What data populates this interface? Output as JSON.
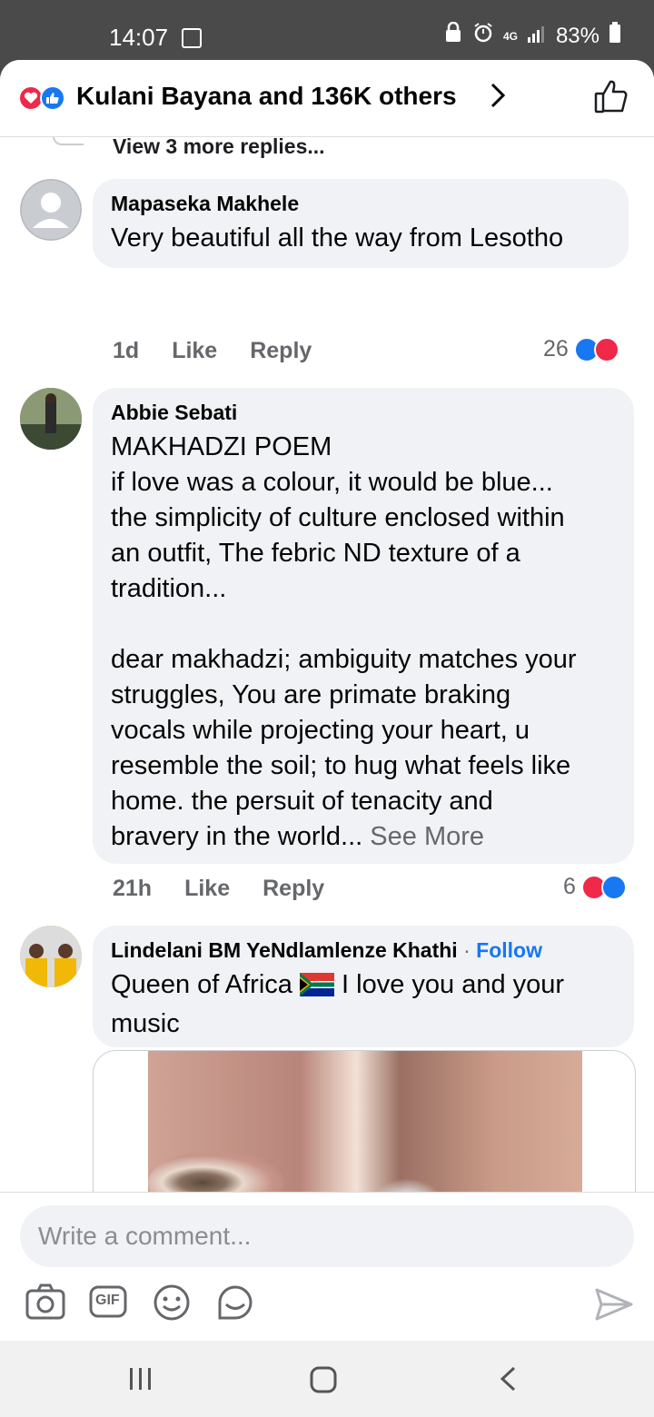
{
  "status": {
    "time": "14:07",
    "network": "4G",
    "battery": "83%"
  },
  "header": {
    "title": "Kulani Bayana and 136K others"
  },
  "view_more": "View 3 more replies...",
  "comments": [
    {
      "name": "Mapaseka Makhele",
      "text": "Very beautiful all the way from Lesotho",
      "time": "1d",
      "like_label": "Like",
      "reply_label": "Reply",
      "reaction_count": "26"
    },
    {
      "name": "Abbie Sebati",
      "text": "MAKHADZI POEM\nif love was a colour, it would be blue...\nthe simplicity of culture enclosed within\nan outfit, The febric ND texture of a\ntradition...\n\ndear makhadzi; ambiguity matches your\nstruggles, You are primate braking\nvocals while projecting your heart, u\nresemble the soil; to hug what feels like\nhome. the persuit of tenacity and\nbravery in the world... ",
      "see_more": "See More",
      "time": "21h",
      "like_label": "Like",
      "reply_label": "Reply",
      "reaction_count": "6"
    },
    {
      "name": "Lindelani BM YeNdlamlenze Khathi",
      "dot": "·",
      "follow": "Follow",
      "text_a": "Queen of Africa",
      "text_b": " I love you and your\nmusic"
    }
  ],
  "composer": {
    "placeholder": "Write a comment..."
  },
  "icons": {
    "camera": "camera-icon",
    "gif": "GIF",
    "emoji": "emoji-icon",
    "sticker": "sticker-icon",
    "send": "send-icon"
  },
  "colors": {
    "facebook_blue": "#1877f2",
    "love_red": "#f02849",
    "bubble_gray": "#f0f2f5"
  }
}
